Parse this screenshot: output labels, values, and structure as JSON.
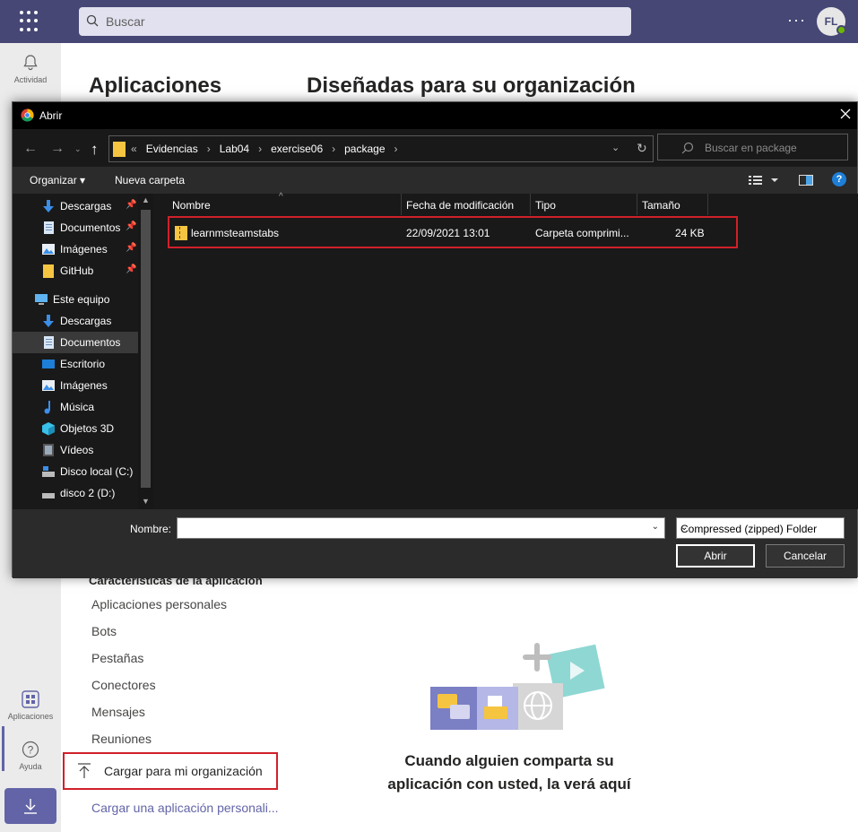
{
  "topbar": {
    "search_placeholder": "Buscar",
    "more": "···",
    "avatar_initials": "FL"
  },
  "rail": {
    "activity": "Actividad",
    "apps": "Aplicaciones",
    "help": "Ayuda"
  },
  "main": {
    "apps_heading": "Aplicaciones",
    "designed_heading": "Diseñadas para su organización",
    "features_title": "Características de la aplicación",
    "features": [
      "Aplicaciones personales",
      "Bots",
      "Pestañas",
      "Conectores",
      "Mensajes",
      "Reuniones"
    ],
    "upload_org": "Cargar para mi organización",
    "upload_personal": "Cargar una aplicación personali...",
    "empty_line1": "Cuando alguien comparta su",
    "empty_line2": "aplicación con usted, la verá aquí"
  },
  "dialog": {
    "title": "Abrir",
    "breadcrumbs": [
      "«",
      "Evidencias",
      "›",
      "Lab04",
      "›",
      "exercise06",
      "›",
      "package",
      "›"
    ],
    "search_placeholder": "Buscar en package",
    "organize": "Organizar ▾",
    "new_folder": "Nueva carpeta",
    "nav_items": [
      {
        "label": "Descargas",
        "icon": "download-arrow-icon",
        "pinned": true
      },
      {
        "label": "Documentos",
        "icon": "documents-icon",
        "pinned": true
      },
      {
        "label": "Imágenes",
        "icon": "pictures-icon",
        "pinned": true
      },
      {
        "label": "GitHub",
        "icon": "folder-icon",
        "pinned": true
      },
      {
        "label": "Este equipo",
        "icon": "computer-icon",
        "pinned": false
      },
      {
        "label": "Descargas",
        "icon": "download-arrow-icon",
        "pinned": false
      },
      {
        "label": "Documentos",
        "icon": "documents-icon",
        "pinned": false
      },
      {
        "label": "Escritorio",
        "icon": "desktop-icon",
        "pinned": false
      },
      {
        "label": "Imágenes",
        "icon": "pictures-icon",
        "pinned": false
      },
      {
        "label": "Música",
        "icon": "music-icon",
        "pinned": false
      },
      {
        "label": "Objetos 3D",
        "icon": "cube-icon",
        "pinned": false
      },
      {
        "label": "Vídeos",
        "icon": "video-icon",
        "pinned": false
      },
      {
        "label": "Disco local (C:)",
        "icon": "drive-icon",
        "pinned": false
      },
      {
        "label": "disco 2 (D:)",
        "icon": "drive-icon",
        "pinned": false
      }
    ],
    "columns": [
      "Nombre",
      "Fecha de modificación",
      "Tipo",
      "Tamaño"
    ],
    "files": [
      {
        "name": "learnmsteamstabs",
        "date": "22/09/2021 13:01",
        "type": "Carpeta comprimi...",
        "size": "24 KB"
      }
    ],
    "filename_label": "Nombre:",
    "filename_value": "",
    "filetype": "Compressed (zipped) Folder",
    "open_button": "Abrir",
    "cancel_button": "Cancelar"
  },
  "colors": {
    "teams_bar": "#464775",
    "accent": "#6264a7",
    "highlight_red": "#d0202a",
    "dialog_bg": "#191919"
  }
}
